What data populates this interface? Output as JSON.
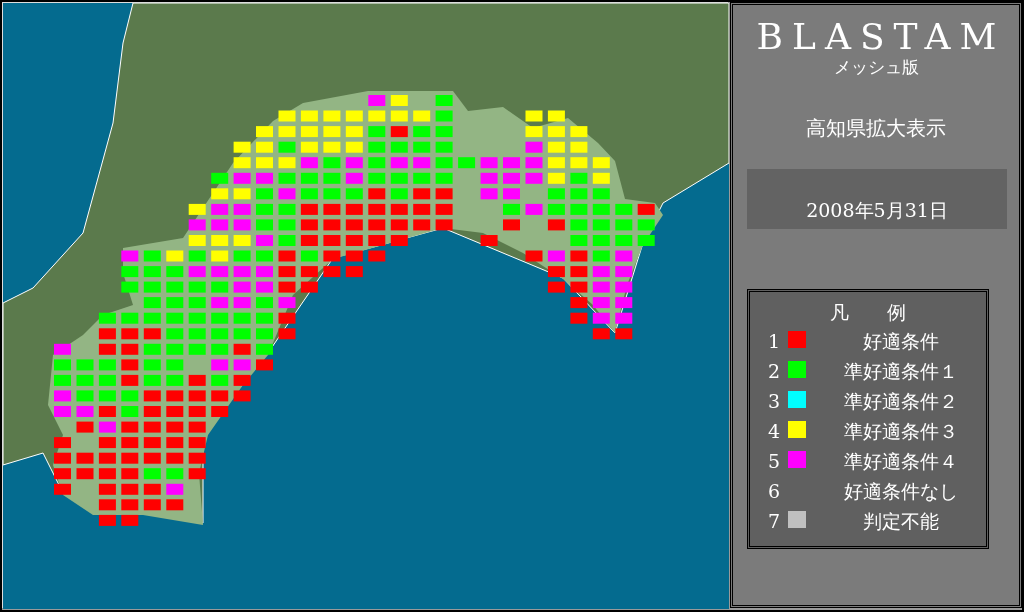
{
  "map": {
    "mesh": {
      "rows": [
        [
          {
            "kind": "gap"
          },
          {
            "kind": "gap"
          },
          {
            "kind": "gap"
          },
          {
            "kind": "gap"
          },
          {
            "kind": "gap"
          },
          {
            "kind": "gap"
          },
          {
            "kind": "gap"
          },
          {
            "kind": "gap"
          },
          {
            "kind": "gap"
          },
          {
            "kind": "gap"
          },
          {
            "kind": "gap"
          },
          {
            "kind": "gap"
          },
          {
            "kind": "gap"
          },
          {
            "kind": "gap"
          },
          {
            "kind": "mesh",
            "color": "#ff00ff"
          },
          {
            "kind": "mesh",
            "color": "#ffff00"
          },
          {
            "kind": "gap"
          },
          {
            "kind": "mesh",
            "color": "#00ff00"
          }
        ],
        [
          {
            "kind": "gap"
          },
          {
            "kind": "gap"
          },
          {
            "kind": "gap"
          },
          {
            "kind": "gap"
          },
          {
            "kind": "gap"
          },
          {
            "kind": "gap"
          },
          {
            "kind": "gap"
          },
          {
            "kind": "gap"
          },
          {
            "kind": "gap"
          },
          {
            "kind": "gap"
          },
          {
            "kind": "mesh",
            "color": "#ffff00"
          },
          {
            "kind": "mesh",
            "color": "#ffff00"
          },
          {
            "kind": "mesh",
            "color": "#ffff00"
          },
          {
            "kind": "mesh",
            "color": "#ffff00"
          },
          {
            "kind": "mesh",
            "color": "#ffff00"
          },
          {
            "kind": "mesh",
            "color": "#ffff00"
          },
          {
            "kind": "mesh",
            "color": "#ffff00"
          },
          {
            "kind": "mesh",
            "color": "#00ff00"
          },
          {
            "kind": "gap"
          },
          {
            "kind": "gap"
          },
          {
            "kind": "gap"
          },
          {
            "kind": "mesh",
            "color": "#ffff00"
          },
          {
            "kind": "mesh",
            "color": "#ffff00"
          }
        ],
        [
          {
            "kind": "gap"
          },
          {
            "kind": "gap"
          },
          {
            "kind": "gap"
          },
          {
            "kind": "gap"
          },
          {
            "kind": "gap"
          },
          {
            "kind": "gap"
          },
          {
            "kind": "gap"
          },
          {
            "kind": "gap"
          },
          {
            "kind": "gap"
          },
          {
            "kind": "mesh",
            "color": "#ffff00"
          },
          {
            "kind": "mesh",
            "color": "#ffff00"
          },
          {
            "kind": "mesh",
            "color": "#ffff00"
          },
          {
            "kind": "mesh",
            "color": "#ffff00"
          },
          {
            "kind": "mesh",
            "color": "#ffff00"
          },
          {
            "kind": "mesh",
            "color": "#00ff00"
          },
          {
            "kind": "mesh",
            "color": "#ff0000"
          },
          {
            "kind": "mesh",
            "color": "#00ff00"
          },
          {
            "kind": "mesh",
            "color": "#00ff00"
          },
          {
            "kind": "gap"
          },
          {
            "kind": "gap"
          },
          {
            "kind": "gap"
          },
          {
            "kind": "mesh",
            "color": "#ffff00"
          },
          {
            "kind": "mesh",
            "color": "#ffff00"
          },
          {
            "kind": "mesh",
            "color": "#ffff00"
          }
        ],
        [
          {
            "kind": "gap"
          },
          {
            "kind": "gap"
          },
          {
            "kind": "gap"
          },
          {
            "kind": "gap"
          },
          {
            "kind": "gap"
          },
          {
            "kind": "gap"
          },
          {
            "kind": "gap"
          },
          {
            "kind": "gap"
          },
          {
            "kind": "mesh",
            "color": "#ffff00"
          },
          {
            "kind": "mesh",
            "color": "#ffff00"
          },
          {
            "kind": "mesh",
            "color": "#00ff00"
          },
          {
            "kind": "mesh",
            "color": "#ffff00"
          },
          {
            "kind": "mesh",
            "color": "#ffff00"
          },
          {
            "kind": "mesh",
            "color": "#ffff00"
          },
          {
            "kind": "mesh",
            "color": "#00ff00"
          },
          {
            "kind": "mesh",
            "color": "#00ff00"
          },
          {
            "kind": "mesh",
            "color": "#00ff00"
          },
          {
            "kind": "mesh",
            "color": "#00ff00"
          },
          {
            "kind": "gap"
          },
          {
            "kind": "gap"
          },
          {
            "kind": "gap"
          },
          {
            "kind": "mesh",
            "color": "#ff00ff"
          },
          {
            "kind": "mesh",
            "color": "#ffff00"
          },
          {
            "kind": "mesh",
            "color": "#ffff00"
          }
        ],
        [
          {
            "kind": "gap"
          },
          {
            "kind": "gap"
          },
          {
            "kind": "gap"
          },
          {
            "kind": "gap"
          },
          {
            "kind": "gap"
          },
          {
            "kind": "gap"
          },
          {
            "kind": "gap"
          },
          {
            "kind": "gap"
          },
          {
            "kind": "mesh",
            "color": "#ffff00"
          },
          {
            "kind": "mesh",
            "color": "#ffff00"
          },
          {
            "kind": "mesh",
            "color": "#ffff00"
          },
          {
            "kind": "mesh",
            "color": "#ff00ff"
          },
          {
            "kind": "mesh",
            "color": "#00ff00"
          },
          {
            "kind": "mesh",
            "color": "#ff00ff"
          },
          {
            "kind": "mesh",
            "color": "#00ff00"
          },
          {
            "kind": "mesh",
            "color": "#ff00ff"
          },
          {
            "kind": "mesh",
            "color": "#ff00ff"
          },
          {
            "kind": "mesh",
            "color": "#00ff00"
          },
          {
            "kind": "mesh",
            "color": "#00ff00"
          },
          {
            "kind": "mesh",
            "color": "#ff00ff"
          },
          {
            "kind": "mesh",
            "color": "#ff00ff"
          },
          {
            "kind": "mesh",
            "color": "#ff00ff"
          },
          {
            "kind": "mesh",
            "color": "#ffff00"
          },
          {
            "kind": "mesh",
            "color": "#ffff00"
          },
          {
            "kind": "mesh",
            "color": "#ffff00"
          }
        ],
        [
          {
            "kind": "gap"
          },
          {
            "kind": "gap"
          },
          {
            "kind": "gap"
          },
          {
            "kind": "gap"
          },
          {
            "kind": "gap"
          },
          {
            "kind": "gap"
          },
          {
            "kind": "gap"
          },
          {
            "kind": "mesh",
            "color": "#00ff00"
          },
          {
            "kind": "mesh",
            "color": "#ff00ff"
          },
          {
            "kind": "mesh",
            "color": "#ff00ff"
          },
          {
            "kind": "mesh",
            "color": "#00ff00"
          },
          {
            "kind": "mesh",
            "color": "#00ff00"
          },
          {
            "kind": "mesh",
            "color": "#00ff00"
          },
          {
            "kind": "mesh",
            "color": "#ff00ff"
          },
          {
            "kind": "mesh",
            "color": "#00ff00"
          },
          {
            "kind": "mesh",
            "color": "#00ff00"
          },
          {
            "kind": "mesh",
            "color": "#00ff00"
          },
          {
            "kind": "mesh",
            "color": "#00ff00"
          },
          {
            "kind": "gap"
          },
          {
            "kind": "mesh",
            "color": "#ff00ff"
          },
          {
            "kind": "mesh",
            "color": "#ff00ff"
          },
          {
            "kind": "mesh",
            "color": "#ff00ff"
          },
          {
            "kind": "mesh",
            "color": "#ffff00"
          },
          {
            "kind": "mesh",
            "color": "#00ff00"
          },
          {
            "kind": "mesh",
            "color": "#ffff00"
          }
        ],
        [
          {
            "kind": "gap"
          },
          {
            "kind": "gap"
          },
          {
            "kind": "gap"
          },
          {
            "kind": "gap"
          },
          {
            "kind": "gap"
          },
          {
            "kind": "gap"
          },
          {
            "kind": "gap"
          },
          {
            "kind": "mesh",
            "color": "#ffff00"
          },
          {
            "kind": "mesh",
            "color": "#ffff00"
          },
          {
            "kind": "mesh",
            "color": "#00ff00"
          },
          {
            "kind": "mesh",
            "color": "#ff00ff"
          },
          {
            "kind": "mesh",
            "color": "#00ff00"
          },
          {
            "kind": "mesh",
            "color": "#00ff00"
          },
          {
            "kind": "mesh",
            "color": "#00ff00"
          },
          {
            "kind": "mesh",
            "color": "#ff0000"
          },
          {
            "kind": "mesh",
            "color": "#00ff00"
          },
          {
            "kind": "mesh",
            "color": "#ff0000"
          },
          {
            "kind": "mesh",
            "color": "#ff0000"
          },
          {
            "kind": "gap"
          },
          {
            "kind": "mesh",
            "color": "#ff00ff"
          },
          {
            "kind": "mesh",
            "color": "#ff00ff"
          },
          {
            "kind": "gap"
          },
          {
            "kind": "mesh",
            "color": "#00ff00"
          },
          {
            "kind": "mesh",
            "color": "#00ff00"
          },
          {
            "kind": "mesh",
            "color": "#00ff00"
          }
        ],
        [
          {
            "kind": "gap"
          },
          {
            "kind": "gap"
          },
          {
            "kind": "gap"
          },
          {
            "kind": "gap"
          },
          {
            "kind": "gap"
          },
          {
            "kind": "gap"
          },
          {
            "kind": "mesh",
            "color": "#ffff00"
          },
          {
            "kind": "mesh",
            "color": "#ff00ff"
          },
          {
            "kind": "mesh",
            "color": "#ff00ff"
          },
          {
            "kind": "mesh",
            "color": "#00ff00"
          },
          {
            "kind": "mesh",
            "color": "#00ff00"
          },
          {
            "kind": "mesh",
            "color": "#ff0000"
          },
          {
            "kind": "mesh",
            "color": "#ff0000"
          },
          {
            "kind": "mesh",
            "color": "#ff0000"
          },
          {
            "kind": "mesh",
            "color": "#ff0000"
          },
          {
            "kind": "mesh",
            "color": "#ff0000"
          },
          {
            "kind": "mesh",
            "color": "#ff0000"
          },
          {
            "kind": "mesh",
            "color": "#ff0000"
          },
          {
            "kind": "gap"
          },
          {
            "kind": "gap"
          },
          {
            "kind": "mesh",
            "color": "#00ff00"
          },
          {
            "kind": "mesh",
            "color": "#ff00ff"
          },
          {
            "kind": "mesh",
            "color": "#00ff00"
          },
          {
            "kind": "mesh",
            "color": "#00ff00"
          },
          {
            "kind": "mesh",
            "color": "#00ff00"
          },
          {
            "kind": "mesh",
            "color": "#00ff00"
          },
          {
            "kind": "mesh",
            "color": "#ff0000"
          }
        ],
        [
          {
            "kind": "gap"
          },
          {
            "kind": "gap"
          },
          {
            "kind": "gap"
          },
          {
            "kind": "gap"
          },
          {
            "kind": "gap"
          },
          {
            "kind": "gap"
          },
          {
            "kind": "mesh",
            "color": "#ff00ff"
          },
          {
            "kind": "mesh",
            "color": "#ff00ff"
          },
          {
            "kind": "mesh",
            "color": "#ff00ff"
          },
          {
            "kind": "mesh",
            "color": "#00ff00"
          },
          {
            "kind": "mesh",
            "color": "#00ff00"
          },
          {
            "kind": "mesh",
            "color": "#ff0000"
          },
          {
            "kind": "mesh",
            "color": "#ff0000"
          },
          {
            "kind": "mesh",
            "color": "#ff0000"
          },
          {
            "kind": "mesh",
            "color": "#ff0000"
          },
          {
            "kind": "mesh",
            "color": "#ff0000"
          },
          {
            "kind": "mesh",
            "color": "#ff0000"
          },
          {
            "kind": "mesh",
            "color": "#ff0000"
          },
          {
            "kind": "gap"
          },
          {
            "kind": "gap"
          },
          {
            "kind": "mesh",
            "color": "#ff0000"
          },
          {
            "kind": "gap"
          },
          {
            "kind": "mesh",
            "color": "#ff0000"
          },
          {
            "kind": "mesh",
            "color": "#00ff00"
          },
          {
            "kind": "mesh",
            "color": "#00ff00"
          },
          {
            "kind": "mesh",
            "color": "#00ff00"
          },
          {
            "kind": "mesh",
            "color": "#00ff00"
          }
        ],
        [
          {
            "kind": "gap"
          },
          {
            "kind": "gap"
          },
          {
            "kind": "gap"
          },
          {
            "kind": "gap"
          },
          {
            "kind": "gap"
          },
          {
            "kind": "gap"
          },
          {
            "kind": "mesh",
            "color": "#ffff00"
          },
          {
            "kind": "mesh",
            "color": "#ffff00"
          },
          {
            "kind": "mesh",
            "color": "#ffff00"
          },
          {
            "kind": "mesh",
            "color": "#ff00ff"
          },
          {
            "kind": "mesh",
            "color": "#00ff00"
          },
          {
            "kind": "mesh",
            "color": "#ff0000"
          },
          {
            "kind": "mesh",
            "color": "#ff0000"
          },
          {
            "kind": "mesh",
            "color": "#ff0000"
          },
          {
            "kind": "mesh",
            "color": "#ff0000"
          },
          {
            "kind": "mesh",
            "color": "#ff0000"
          },
          {
            "kind": "gap"
          },
          {
            "kind": "gap"
          },
          {
            "kind": "gap"
          },
          {
            "kind": "mesh",
            "color": "#ff0000"
          },
          {
            "kind": "gap"
          },
          {
            "kind": "gap"
          },
          {
            "kind": "gap"
          },
          {
            "kind": "mesh",
            "color": "#00ff00"
          },
          {
            "kind": "mesh",
            "color": "#00ff00"
          },
          {
            "kind": "mesh",
            "color": "#00ff00"
          },
          {
            "kind": "mesh",
            "color": "#00ff00"
          }
        ],
        [
          {
            "kind": "gap"
          },
          {
            "kind": "gap"
          },
          {
            "kind": "gap"
          },
          {
            "kind": "mesh",
            "color": "#ff00ff"
          },
          {
            "kind": "mesh",
            "color": "#00ff00"
          },
          {
            "kind": "mesh",
            "color": "#ffff00"
          },
          {
            "kind": "mesh",
            "color": "#00ff00"
          },
          {
            "kind": "mesh",
            "color": "#ffff00"
          },
          {
            "kind": "mesh",
            "color": "#00ff00"
          },
          {
            "kind": "mesh",
            "color": "#00ff00"
          },
          {
            "kind": "mesh",
            "color": "#ff0000"
          },
          {
            "kind": "mesh",
            "color": "#00ff00"
          },
          {
            "kind": "mesh",
            "color": "#ff0000"
          },
          {
            "kind": "mesh",
            "color": "#ff0000"
          },
          {
            "kind": "mesh",
            "color": "#ff0000"
          },
          {
            "kind": "gap"
          },
          {
            "kind": "gap"
          },
          {
            "kind": "gap"
          },
          {
            "kind": "gap"
          },
          {
            "kind": "gap"
          },
          {
            "kind": "gap"
          },
          {
            "kind": "mesh",
            "color": "#ff0000"
          },
          {
            "kind": "mesh",
            "color": "#ff00ff"
          },
          {
            "kind": "mesh",
            "color": "#ff0000"
          },
          {
            "kind": "mesh",
            "color": "#00ff00"
          },
          {
            "kind": "mesh",
            "color": "#ff00ff"
          }
        ],
        [
          {
            "kind": "gap"
          },
          {
            "kind": "gap"
          },
          {
            "kind": "gap"
          },
          {
            "kind": "mesh",
            "color": "#00ff00"
          },
          {
            "kind": "mesh",
            "color": "#00ff00"
          },
          {
            "kind": "mesh",
            "color": "#00ff00"
          },
          {
            "kind": "mesh",
            "color": "#ff00ff"
          },
          {
            "kind": "mesh",
            "color": "#ff00ff"
          },
          {
            "kind": "mesh",
            "color": "#ff00ff"
          },
          {
            "kind": "mesh",
            "color": "#ff00ff"
          },
          {
            "kind": "mesh",
            "color": "#ff0000"
          },
          {
            "kind": "mesh",
            "color": "#ff0000"
          },
          {
            "kind": "mesh",
            "color": "#ff0000"
          },
          {
            "kind": "mesh",
            "color": "#ff0000"
          },
          {
            "kind": "gap"
          },
          {
            "kind": "gap"
          },
          {
            "kind": "gap"
          },
          {
            "kind": "gap"
          },
          {
            "kind": "gap"
          },
          {
            "kind": "gap"
          },
          {
            "kind": "gap"
          },
          {
            "kind": "gap"
          },
          {
            "kind": "mesh",
            "color": "#ff0000"
          },
          {
            "kind": "mesh",
            "color": "#ff0000"
          },
          {
            "kind": "mesh",
            "color": "#ff00ff"
          },
          {
            "kind": "mesh",
            "color": "#ff00ff"
          }
        ],
        [
          {
            "kind": "gap"
          },
          {
            "kind": "gap"
          },
          {
            "kind": "gap"
          },
          {
            "kind": "mesh",
            "color": "#00ff00"
          },
          {
            "kind": "mesh",
            "color": "#00ff00"
          },
          {
            "kind": "mesh",
            "color": "#00ff00"
          },
          {
            "kind": "mesh",
            "color": "#00ff00"
          },
          {
            "kind": "mesh",
            "color": "#00ff00"
          },
          {
            "kind": "mesh",
            "color": "#ff00ff"
          },
          {
            "kind": "mesh",
            "color": "#ff00ff"
          },
          {
            "kind": "mesh",
            "color": "#ff0000"
          },
          {
            "kind": "mesh",
            "color": "#ff0000"
          },
          {
            "kind": "gap"
          },
          {
            "kind": "gap"
          },
          {
            "kind": "gap"
          },
          {
            "kind": "gap"
          },
          {
            "kind": "gap"
          },
          {
            "kind": "gap"
          },
          {
            "kind": "gap"
          },
          {
            "kind": "gap"
          },
          {
            "kind": "gap"
          },
          {
            "kind": "gap"
          },
          {
            "kind": "mesh",
            "color": "#ff0000"
          },
          {
            "kind": "mesh",
            "color": "#ff0000"
          },
          {
            "kind": "mesh",
            "color": "#ff00ff"
          },
          {
            "kind": "mesh",
            "color": "#ff00ff"
          }
        ],
        [
          {
            "kind": "gap"
          },
          {
            "kind": "gap"
          },
          {
            "kind": "gap"
          },
          {
            "kind": "gap"
          },
          {
            "kind": "mesh",
            "color": "#00ff00"
          },
          {
            "kind": "mesh",
            "color": "#00ff00"
          },
          {
            "kind": "mesh",
            "color": "#00ff00"
          },
          {
            "kind": "mesh",
            "color": "#ff00ff"
          },
          {
            "kind": "mesh",
            "color": "#ff00ff"
          },
          {
            "kind": "mesh",
            "color": "#00ff00"
          },
          {
            "kind": "mesh",
            "color": "#ff00ff"
          },
          {
            "kind": "gap"
          },
          {
            "kind": "gap"
          },
          {
            "kind": "gap"
          },
          {
            "kind": "gap"
          },
          {
            "kind": "gap"
          },
          {
            "kind": "gap"
          },
          {
            "kind": "gap"
          },
          {
            "kind": "gap"
          },
          {
            "kind": "gap"
          },
          {
            "kind": "gap"
          },
          {
            "kind": "gap"
          },
          {
            "kind": "gap"
          },
          {
            "kind": "mesh",
            "color": "#ff0000"
          },
          {
            "kind": "mesh",
            "color": "#ff00ff"
          },
          {
            "kind": "mesh",
            "color": "#ff00ff"
          }
        ],
        [
          {
            "kind": "gap"
          },
          {
            "kind": "gap"
          },
          {
            "kind": "mesh",
            "color": "#00ff00"
          },
          {
            "kind": "mesh",
            "color": "#00ff00"
          },
          {
            "kind": "mesh",
            "color": "#00ff00"
          },
          {
            "kind": "mesh",
            "color": "#00ff00"
          },
          {
            "kind": "mesh",
            "color": "#00ff00"
          },
          {
            "kind": "mesh",
            "color": "#00ff00"
          },
          {
            "kind": "mesh",
            "color": "#00ff00"
          },
          {
            "kind": "mesh",
            "color": "#00ff00"
          },
          {
            "kind": "mesh",
            "color": "#ff0000"
          },
          {
            "kind": "gap"
          },
          {
            "kind": "gap"
          },
          {
            "kind": "gap"
          },
          {
            "kind": "gap"
          },
          {
            "kind": "gap"
          },
          {
            "kind": "gap"
          },
          {
            "kind": "gap"
          },
          {
            "kind": "gap"
          },
          {
            "kind": "gap"
          },
          {
            "kind": "gap"
          },
          {
            "kind": "gap"
          },
          {
            "kind": "gap"
          },
          {
            "kind": "mesh",
            "color": "#ff0000"
          },
          {
            "kind": "mesh",
            "color": "#ff00ff"
          },
          {
            "kind": "mesh",
            "color": "#ff00ff"
          }
        ],
        [
          {
            "kind": "gap"
          },
          {
            "kind": "gap"
          },
          {
            "kind": "mesh",
            "color": "#ff0000"
          },
          {
            "kind": "mesh",
            "color": "#ff0000"
          },
          {
            "kind": "mesh",
            "color": "#ff0000"
          },
          {
            "kind": "mesh",
            "color": "#00ff00"
          },
          {
            "kind": "mesh",
            "color": "#00ff00"
          },
          {
            "kind": "mesh",
            "color": "#00ff00"
          },
          {
            "kind": "mesh",
            "color": "#00ff00"
          },
          {
            "kind": "mesh",
            "color": "#00ff00"
          },
          {
            "kind": "mesh",
            "color": "#ff0000"
          },
          {
            "kind": "gap"
          },
          {
            "kind": "gap"
          },
          {
            "kind": "gap"
          },
          {
            "kind": "gap"
          },
          {
            "kind": "gap"
          },
          {
            "kind": "gap"
          },
          {
            "kind": "gap"
          },
          {
            "kind": "gap"
          },
          {
            "kind": "gap"
          },
          {
            "kind": "gap"
          },
          {
            "kind": "gap"
          },
          {
            "kind": "gap"
          },
          {
            "kind": "gap"
          },
          {
            "kind": "mesh",
            "color": "#ff0000"
          },
          {
            "kind": "mesh",
            "color": "#ff0000"
          }
        ],
        [
          {
            "kind": "mesh",
            "color": "#ff00ff"
          },
          {
            "kind": "gap"
          },
          {
            "kind": "mesh",
            "color": "#ff0000"
          },
          {
            "kind": "mesh",
            "color": "#ff0000"
          },
          {
            "kind": "mesh",
            "color": "#00ff00"
          },
          {
            "kind": "mesh",
            "color": "#00ff00"
          },
          {
            "kind": "mesh",
            "color": "#00ff00"
          },
          {
            "kind": "mesh",
            "color": "#00ff00"
          },
          {
            "kind": "mesh",
            "color": "#ff0000"
          },
          {
            "kind": "mesh",
            "color": "#00ff00"
          }
        ],
        [
          {
            "kind": "mesh",
            "color": "#00ff00"
          },
          {
            "kind": "mesh",
            "color": "#00ff00"
          },
          {
            "kind": "mesh",
            "color": "#00ff00"
          },
          {
            "kind": "mesh",
            "color": "#ff0000"
          },
          {
            "kind": "mesh",
            "color": "#00ff00"
          },
          {
            "kind": "mesh",
            "color": "#00ff00"
          },
          {
            "kind": "gap"
          },
          {
            "kind": "mesh",
            "color": "#ff00ff"
          },
          {
            "kind": "mesh",
            "color": "#ff00ff"
          },
          {
            "kind": "mesh",
            "color": "#ff0000"
          }
        ],
        [
          {
            "kind": "mesh",
            "color": "#00ff00"
          },
          {
            "kind": "mesh",
            "color": "#00ff00"
          },
          {
            "kind": "mesh",
            "color": "#00ff00"
          },
          {
            "kind": "mesh",
            "color": "#ff0000"
          },
          {
            "kind": "mesh",
            "color": "#00ff00"
          },
          {
            "kind": "mesh",
            "color": "#00ff00"
          },
          {
            "kind": "mesh",
            "color": "#ff0000"
          },
          {
            "kind": "mesh",
            "color": "#00ff00"
          },
          {
            "kind": "mesh",
            "color": "#ff0000"
          }
        ],
        [
          {
            "kind": "mesh",
            "color": "#ff00ff"
          },
          {
            "kind": "mesh",
            "color": "#00ff00"
          },
          {
            "kind": "mesh",
            "color": "#00ff00"
          },
          {
            "kind": "mesh",
            "color": "#00ff00"
          },
          {
            "kind": "mesh",
            "color": "#ff0000"
          },
          {
            "kind": "mesh",
            "color": "#ff0000"
          },
          {
            "kind": "mesh",
            "color": "#ff0000"
          },
          {
            "kind": "mesh",
            "color": "#ff0000"
          },
          {
            "kind": "mesh",
            "color": "#ff0000"
          }
        ],
        [
          {
            "kind": "mesh",
            "color": "#ff00ff"
          },
          {
            "kind": "mesh",
            "color": "#ff00ff"
          },
          {
            "kind": "mesh",
            "color": "#ff0000"
          },
          {
            "kind": "mesh",
            "color": "#00ff00"
          },
          {
            "kind": "mesh",
            "color": "#ff0000"
          },
          {
            "kind": "mesh",
            "color": "#ff0000"
          },
          {
            "kind": "mesh",
            "color": "#ff0000"
          },
          {
            "kind": "mesh",
            "color": "#ff0000"
          }
        ],
        [
          {
            "kind": "gap"
          },
          {
            "kind": "mesh",
            "color": "#ff0000"
          },
          {
            "kind": "mesh",
            "color": "#ff00ff"
          },
          {
            "kind": "mesh",
            "color": "#ff0000"
          },
          {
            "kind": "mesh",
            "color": "#ff0000"
          },
          {
            "kind": "mesh",
            "color": "#ff0000"
          },
          {
            "kind": "mesh",
            "color": "#ff0000"
          }
        ],
        [
          {
            "kind": "mesh",
            "color": "#ff0000"
          },
          {
            "kind": "gap"
          },
          {
            "kind": "mesh",
            "color": "#ff0000"
          },
          {
            "kind": "mesh",
            "color": "#ff0000"
          },
          {
            "kind": "mesh",
            "color": "#ff0000"
          },
          {
            "kind": "mesh",
            "color": "#ff0000"
          },
          {
            "kind": "mesh",
            "color": "#ff0000"
          }
        ],
        [
          {
            "kind": "mesh",
            "color": "#ff0000"
          },
          {
            "kind": "mesh",
            "color": "#ff0000"
          },
          {
            "kind": "mesh",
            "color": "#ff0000"
          },
          {
            "kind": "mesh",
            "color": "#ff0000"
          },
          {
            "kind": "mesh",
            "color": "#ff0000"
          },
          {
            "kind": "mesh",
            "color": "#ff0000"
          },
          {
            "kind": "mesh",
            "color": "#ff0000"
          }
        ],
        [
          {
            "kind": "mesh",
            "color": "#ff0000"
          },
          {
            "kind": "mesh",
            "color": "#ff0000"
          },
          {
            "kind": "mesh",
            "color": "#ff0000"
          },
          {
            "kind": "mesh",
            "color": "#ff0000"
          },
          {
            "kind": "mesh",
            "color": "#00ff00"
          },
          {
            "kind": "mesh",
            "color": "#00ff00"
          },
          {
            "kind": "mesh",
            "color": "#ff0000"
          }
        ],
        [
          {
            "kind": "mesh",
            "color": "#ff0000"
          },
          {
            "kind": "gap"
          },
          {
            "kind": "mesh",
            "color": "#ff0000"
          },
          {
            "kind": "mesh",
            "color": "#ff0000"
          },
          {
            "kind": "mesh",
            "color": "#ff0000"
          },
          {
            "kind": "mesh",
            "color": "#ff00ff"
          }
        ],
        [
          {
            "kind": "gap"
          },
          {
            "kind": "gap"
          },
          {
            "kind": "mesh",
            "color": "#ff0000"
          },
          {
            "kind": "mesh",
            "color": "#ff0000"
          },
          {
            "kind": "mesh",
            "color": "#ff0000"
          },
          {
            "kind": "mesh",
            "color": "#ff0000"
          }
        ],
        [
          {
            "kind": "gap"
          },
          {
            "kind": "gap"
          },
          {
            "kind": "mesh",
            "color": "#ff0000"
          },
          {
            "kind": "mesh",
            "color": "#ff0000"
          }
        ]
      ]
    }
  },
  "panel": {
    "title": "BLASTAM",
    "subtitle": "メッシュ版",
    "region": "高知県拡大表示",
    "date": "2008年5月31日",
    "legend": {
      "title": "凡　　例",
      "items": [
        {
          "number": "1",
          "label": "好適条件",
          "color": "#ff0000"
        },
        {
          "number": "2",
          "label": "準好適条件１",
          "color": "#00ff00"
        },
        {
          "number": "3",
          "label": "準好適条件２",
          "color": "#00ffff"
        },
        {
          "number": "4",
          "label": "準好適条件３",
          "color": "#ffff00"
        },
        {
          "number": "5",
          "label": "準好適条件４",
          "color": "#ff00ff"
        },
        {
          "number": "6",
          "label": "好適条件なし"
        },
        {
          "number": "7",
          "label": "判定不能",
          "color": "#c0c0c0"
        }
      ]
    }
  }
}
